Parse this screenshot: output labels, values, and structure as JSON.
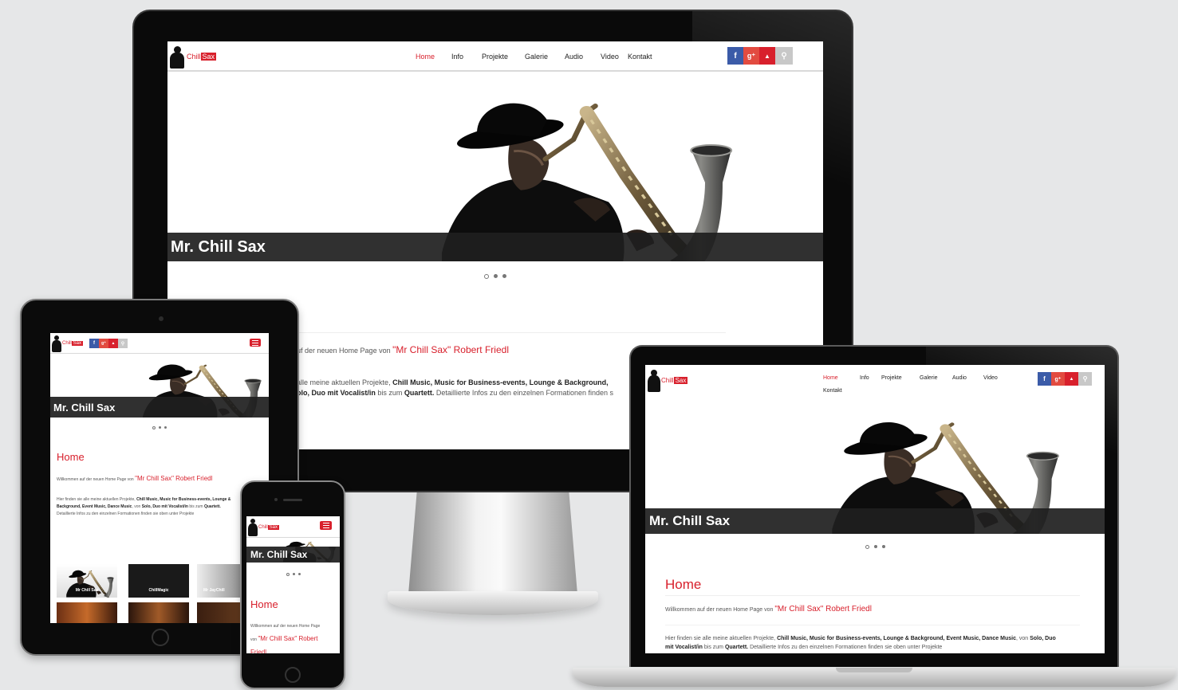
{
  "site": {
    "logo_chill": "Chill",
    "logo_sax": "Sax",
    "nav": [
      "Home",
      "Info",
      "Projekte",
      "Galerie",
      "Audio",
      "Video",
      "Kontakt"
    ],
    "social": {
      "facebook": "f",
      "google": "g⁺",
      "youtube": "▲",
      "search": "⚲"
    },
    "hero_caption": "Mr. Chill Sax",
    "page_heading": "Home",
    "welcome_prefix": "Willkommen auf der neuen Home Page von ",
    "welcome_highlight": "\"Mr Chill Sax\" Robert Friedl",
    "welcome_short": "Willkommen auf der neuen Home Page von",
    "welcome_short_highlight": "\"Mr Chill Sax\" Robert Friedl",
    "intro_prefix": "Hier finden sie alle meine aktuellen Projekte, ",
    "intro_bold1": "Chill Music, Music for Business-events, Lounge & Background, Event Music, Dance Music",
    "intro_mid": ", von ",
    "intro_bold2": "Solo, Duo mit Vocalist/in",
    "intro_mid2": " bis zum ",
    "intro_bold3": "Quartett.",
    "intro_suffix": " Detaillierte Infos zu den einzelnen Formationen finden sie oben unter Projekte",
    "desktop_welcome_partial": "uf der neuen Home Page von ",
    "desktop_intro_partial1": "alle meine aktuellen Projekte, ",
    "desktop_intro_bold1": "Chill Music, Music for Business-events, Lounge & Background,",
    "desktop_intro_bold2": "olo, Duo mit Vocalist/in",
    "desktop_intro_partial2": " bis zum ",
    "desktop_intro_bold3": "Quartett.",
    "desktop_intro_partial3": " Detaillierte Infos zu den einzelnen Formationen finden s",
    "gallery": [
      "Mr Chill Sax",
      "ChillMagic",
      "Mr JayChill"
    ]
  },
  "colors": {
    "accent": "#d8202c",
    "facebook": "#3b5ba8",
    "google": "#e24b40",
    "device_black": "#0a0a0a",
    "background": "#e6e7e8"
  },
  "devices": [
    "desktop-monitor",
    "tablet",
    "smartphone",
    "laptop"
  ]
}
